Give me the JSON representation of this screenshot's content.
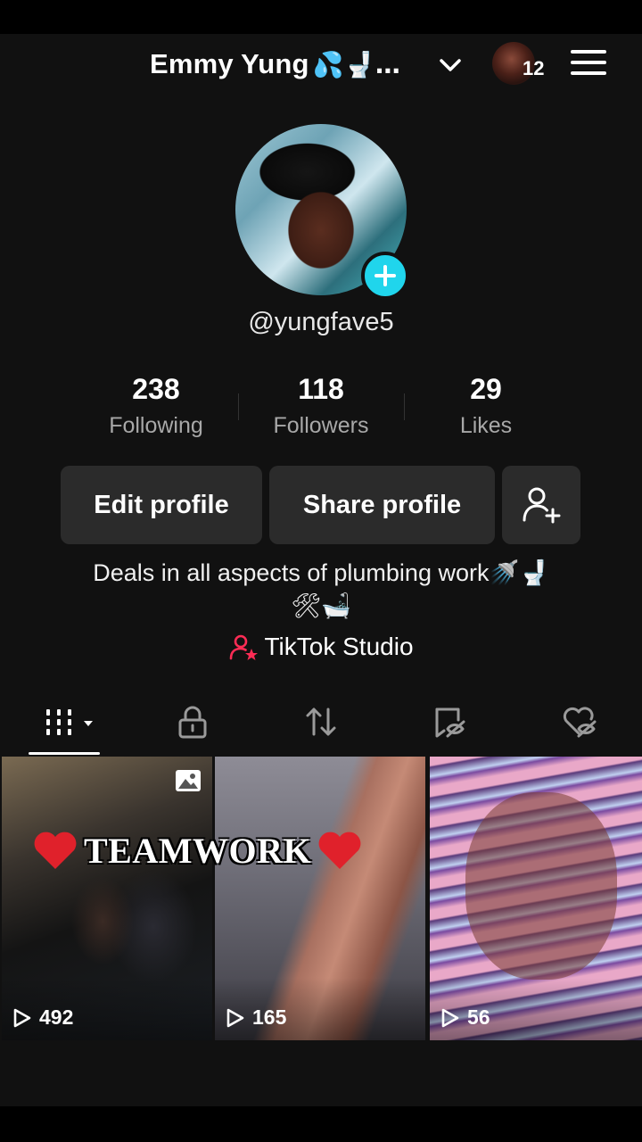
{
  "header": {
    "name": "Emmy Yung",
    "name_emoji": "💦🚽…",
    "notification_count": "12"
  },
  "profile": {
    "username": "@yungfave5",
    "stats": [
      {
        "value": "238",
        "label": "Following"
      },
      {
        "value": "118",
        "label": "Followers"
      },
      {
        "value": "29",
        "label": "Likes"
      }
    ],
    "edit_label": "Edit profile",
    "share_label": "Share profile",
    "bio_line1": "Deals in all aspects of plumbing work",
    "bio_line1_emoji": "🚿🚽",
    "bio_line2_emoji": "🛠🛁",
    "studio_label": "TikTok Studio"
  },
  "tabs": [
    "videos-grid",
    "private",
    "reposts",
    "favorites",
    "liked"
  ],
  "videos": [
    {
      "caption": "TEAMWORK",
      "plays": "492"
    },
    {
      "plays": "165"
    },
    {
      "plays": "56"
    }
  ],
  "colors": {
    "accent": "#20d5ec",
    "studio_icon": "#fe2c55",
    "heart": "#e0212b"
  }
}
